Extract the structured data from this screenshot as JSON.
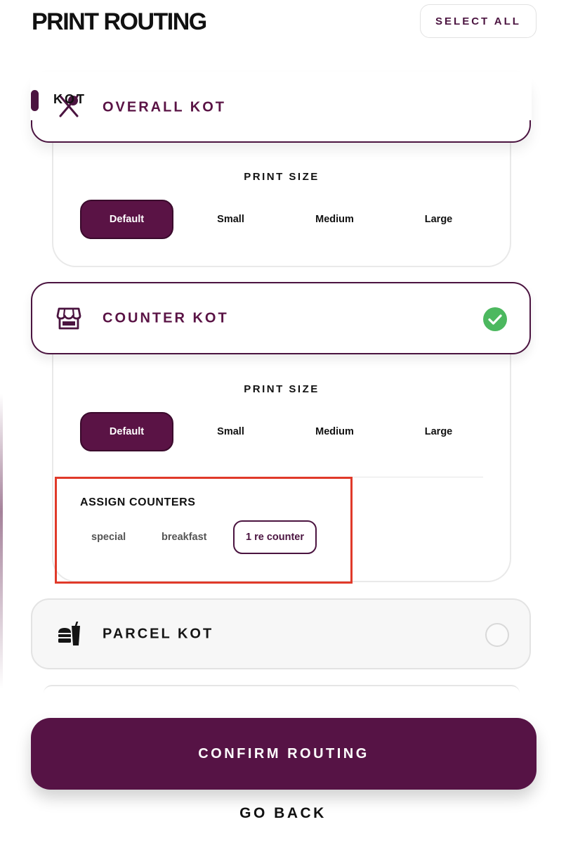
{
  "header": {
    "title": "PRINT ROUTING",
    "select_all_label": "SELECT ALL"
  },
  "peek": {
    "text": "KOT"
  },
  "overall_kot": {
    "label": "OVERALL KOT",
    "icon": "fork-knife-icon",
    "print_size_title": "PRINT SIZE",
    "sizes": [
      "Default",
      "Small",
      "Medium",
      "Large"
    ],
    "selected_size": "Default"
  },
  "counter_kot": {
    "label": "COUNTER KOT",
    "icon": "store-icon",
    "checked": true,
    "print_size_title": "PRINT SIZE",
    "sizes": [
      "Default",
      "Small",
      "Medium",
      "Large"
    ],
    "selected_size": "Default",
    "assign_title": "ASSIGN COUNTERS",
    "counters": [
      "special",
      "breakfast",
      "1 re counter"
    ],
    "selected_counter": "1 re counter"
  },
  "parcel_kot": {
    "label": "PARCEL KOT",
    "icon": "takeaway-bag-icon",
    "checked": false
  },
  "footer": {
    "confirm_label": "CONFIRM ROUTING",
    "back_label": "GO BACK"
  },
  "colors": {
    "brand": "#561345",
    "brand_dark": "#4b1440",
    "check_green": "#4cb85f",
    "highlight_red": "#e03a2a"
  }
}
